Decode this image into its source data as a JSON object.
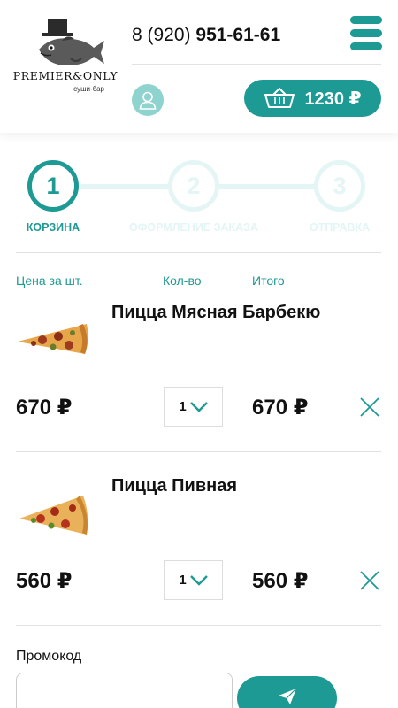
{
  "brand": {
    "title": "PREMIER&ONLY",
    "subtitle": "суши-бар",
    "logo_icon": "fish-in-top-hat-icon"
  },
  "header": {
    "phone_prefix": "8 (920)",
    "phone_number": "951-61-61",
    "menu_icon": "hamburger-menu-icon",
    "user_icon": "user-icon",
    "cart_icon": "basket-icon",
    "cart_total": "1230 ₽"
  },
  "steps": [
    {
      "number": "1",
      "label": "КОРЗИНА",
      "active": true
    },
    {
      "number": "2",
      "label": "ОФОРМЛЕНИЕ ЗАКАЗА",
      "active": false
    },
    {
      "number": "3",
      "label": "ОТПРАВКА",
      "active": false
    }
  ],
  "columns": {
    "price": "Цена за шт.",
    "qty": "Кол-во",
    "total": "Итого"
  },
  "items": [
    {
      "name": "Пицца Мясная Барбекю",
      "price": "670 ₽",
      "qty": "1",
      "total": "670 ₽"
    },
    {
      "name": "Пицца Пивная",
      "price": "560 ₽",
      "qty": "1",
      "total": "560 ₽"
    }
  ],
  "promo": {
    "label": "Промокод",
    "value": "",
    "placeholder": "",
    "submit_icon": "paper-plane-icon"
  },
  "colors": {
    "accent": "#1d9a94",
    "accent_light": "#e3f5f4",
    "user_bg": "#8fd3cf"
  }
}
